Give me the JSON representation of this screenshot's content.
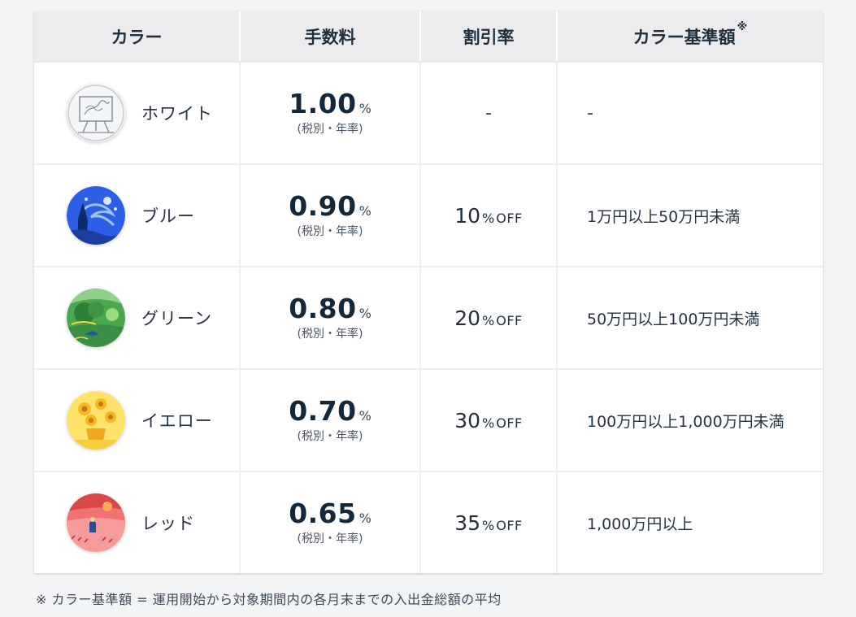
{
  "headers": {
    "color": "カラー",
    "fee": "手数料",
    "discount": "割引率",
    "threshold": "カラー基準額",
    "threshold_mark": "※"
  },
  "rows": [
    {
      "name": "ホワイト",
      "icon": "white-painting-icon",
      "fee": "1.00",
      "fee_unit": "%",
      "fee_note": "(税別・年率)",
      "discount": "-",
      "discount_unit": "",
      "discount_off": "",
      "range": "-"
    },
    {
      "name": "ブルー",
      "icon": "blue-starry-night-icon",
      "fee": "0.90",
      "fee_unit": "%",
      "fee_note": "(税別・年率)",
      "discount": "10",
      "discount_unit": "%",
      "discount_off": "OFF",
      "range": "1万円以上50万円未満"
    },
    {
      "name": "グリーン",
      "icon": "green-landscape-icon",
      "fee": "0.80",
      "fee_unit": "%",
      "fee_note": "(税別・年率)",
      "discount": "20",
      "discount_unit": "%",
      "discount_off": "OFF",
      "range": "50万円以上100万円未満"
    },
    {
      "name": "イエロー",
      "icon": "yellow-sunflowers-icon",
      "fee": "0.70",
      "fee_unit": "%",
      "fee_note": "(税別・年率)",
      "discount": "30",
      "discount_unit": "%",
      "discount_off": "OFF",
      "range": "100万円以上1,000万円未満"
    },
    {
      "name": "レッド",
      "icon": "red-field-icon",
      "fee": "0.65",
      "fee_unit": "%",
      "fee_note": "(税別・年率)",
      "discount": "35",
      "discount_unit": "%",
      "discount_off": "OFF",
      "range": "1,000万円以上"
    }
  ],
  "footnote": "※ カラー基準額 = 運用開始から対象期間内の各月末までの入出金総額の平均"
}
